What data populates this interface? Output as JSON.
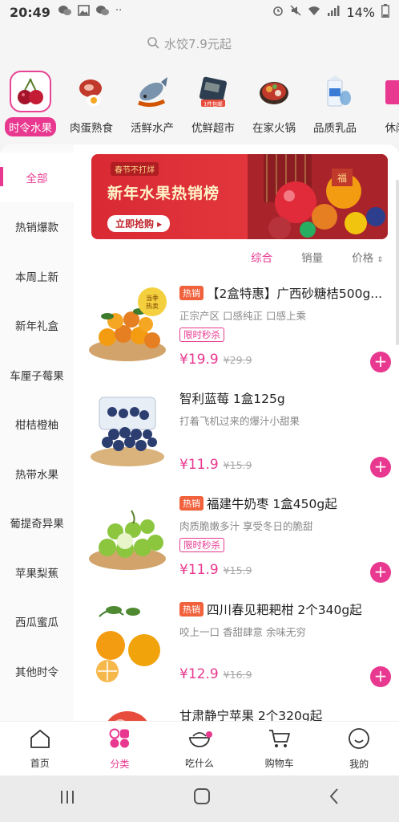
{
  "status_bar": {
    "time": "20:49",
    "battery_percent": "14%"
  },
  "search": {
    "placeholder": "水饺7.9元起"
  },
  "categories": [
    {
      "label": "时令水果",
      "icon": "cherries-icon",
      "active": true
    },
    {
      "label": "肉蛋熟食",
      "icon": "meat-egg-icon"
    },
    {
      "label": "活鲜水产",
      "icon": "fish-icon"
    },
    {
      "label": "优鲜超市",
      "icon": "supermarket-icon"
    },
    {
      "label": "在家火锅",
      "icon": "hotpot-icon"
    },
    {
      "label": "品质乳品",
      "icon": "milk-icon"
    },
    {
      "label": "休闲",
      "icon": "snack-icon"
    }
  ],
  "sidebar": {
    "items": [
      {
        "label": "全部",
        "active": true
      },
      {
        "label": "热销爆款"
      },
      {
        "label": "本周上新"
      },
      {
        "label": "新年礼盒"
      },
      {
        "label": "车厘子莓果"
      },
      {
        "label": "柑桔橙柚"
      },
      {
        "label": "热带水果"
      },
      {
        "label": "葡提奇异果"
      },
      {
        "label": "苹果梨蕉"
      },
      {
        "label": "西瓜蜜瓜"
      },
      {
        "label": "其他时令"
      }
    ]
  },
  "banner": {
    "tag": "春节不打烊",
    "title": "新年水果热销榜",
    "cta": "立即抢购 ▸"
  },
  "sort": {
    "comprehensive": "综合",
    "sales": "销量",
    "price": "价格"
  },
  "products": [
    {
      "hot": "热销",
      "name": "【2盒特惠】广西砂糖桔500g...",
      "desc": "正宗产区 口感纯正 口感上乘",
      "flash": "限时秒杀",
      "price": "¥19.9",
      "orig": "¥29.9",
      "badge": "当季热卖"
    },
    {
      "hot": "",
      "name": "智利蓝莓 1盒125g",
      "desc": "打着飞机过来的爆汁小甜果",
      "flash": "",
      "price": "¥11.9",
      "orig": "¥15.9"
    },
    {
      "hot": "热销",
      "name": "福建牛奶枣 1盒450g起",
      "desc": "肉质脆嫩多汁 享受冬日的脆甜",
      "flash": "限时秒杀",
      "price": "¥11.9",
      "orig": "¥15.9"
    },
    {
      "hot": "热销",
      "name": "四川春见耙耙柑 2个340g起",
      "desc": "咬上一口 香甜肆意 余味无穷",
      "flash": "",
      "price": "¥12.9",
      "orig": "¥16.9"
    },
    {
      "hot": "",
      "name": "甘肃静宁苹果 2个320g起",
      "desc": "",
      "flash": "",
      "price": "",
      "orig": ""
    }
  ],
  "tabbar": [
    {
      "label": "首页",
      "icon": "home-icon"
    },
    {
      "label": "分类",
      "icon": "category-icon",
      "active": true
    },
    {
      "label": "吃什么",
      "icon": "bowl-icon"
    },
    {
      "label": "购物车",
      "icon": "cart-icon"
    },
    {
      "label": "我的",
      "icon": "profile-icon"
    }
  ],
  "colors": {
    "accent": "#e8388f",
    "hot_tag": "#f0613c"
  }
}
